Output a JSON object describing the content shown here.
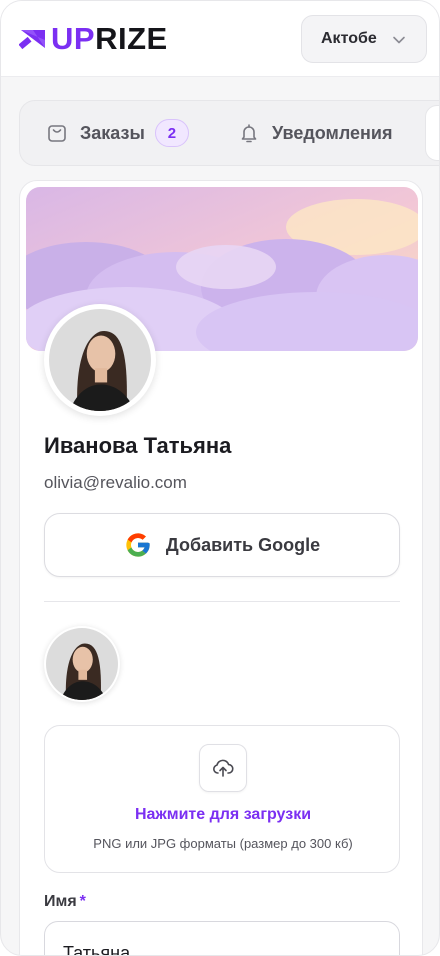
{
  "app": {
    "logo": {
      "part1": "UP",
      "part2": "RIZE"
    },
    "city_select": {
      "value": "Актобе"
    }
  },
  "tabs": [
    {
      "label": "Заказы",
      "icon": "bag-icon",
      "badge": "2"
    },
    {
      "label": "Уведомления",
      "icon": "bell-icon"
    }
  ],
  "profile": {
    "name": "Иванова Татьяна",
    "email": "olivia@revalio.com",
    "google_button": "Добавить Google"
  },
  "upload": {
    "cta": "Нажмите для загрузки",
    "hint": "PNG или JPG форматы (размер до 300 кб)"
  },
  "form": {
    "name_label": "Имя",
    "required_mark": "*",
    "name_value": "Татьяна"
  },
  "colors": {
    "accent": "#7b2ff2",
    "badge_bg": "#f1e7ff"
  }
}
